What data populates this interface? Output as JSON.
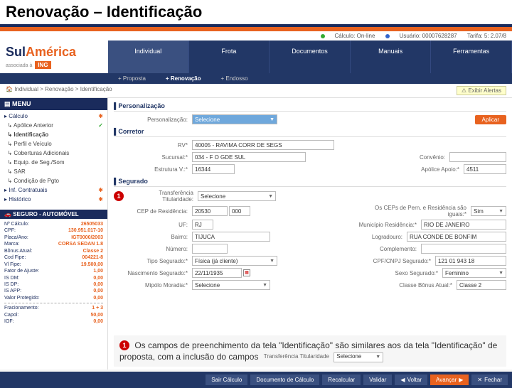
{
  "slide_title": "Renovação – Identificação",
  "status": {
    "calc": "Cálculo: On-line",
    "user": "Usuário: 00007628287",
    "tarifa": "Tarifa: 5: 2.07/8"
  },
  "logo": {
    "brand": "SulAmérica",
    "sub": "associada à",
    "ing": "ING"
  },
  "nav": [
    "Individual",
    "Frota",
    "Documentos",
    "Manuais",
    "Ferramentas"
  ],
  "subnav": [
    "+ Proposta",
    "+ Renovação",
    "+ Endosso"
  ],
  "breadcrumb": "Individual > Renovação > Identificação",
  "alert_btn": "⚠ Exibir Alertas",
  "menu_head": "MENU",
  "menu": {
    "calc": "Cálculo",
    "apolice": "Apólice Anterior",
    "ident": "Identificação",
    "perfil": "Perfil e Veículo",
    "cob": "Coberturas Adicionais",
    "equip": "Equip. de Seg./Som",
    "sar": "SAR",
    "cond": "Condição de Pgto",
    "info": "Inf. Contratuais",
    "hist": "Histórico"
  },
  "summary_head": "SEGURO - AUTOMÓVEL",
  "summary": {
    "ncalc_k": "Nº Cálculo:",
    "ncalc_v": "26505033",
    "cpf_k": "CPF:",
    "cpf_v": "130.951.017-10",
    "placa_k": "Placa/Ano:",
    "placa_v": "IGT0000/2003",
    "marca_k": "Marca:",
    "marca_v": "CORSA SEDAN 1.8",
    "bonus_k": "Bônus Atual:",
    "bonus_v": "Classe 2",
    "cod_k": "Cod Fipe:",
    "cod_v": "004221-8",
    "vl_k": "Vl Fipe:",
    "vl_v": "19.500,00",
    "fator_k": "Fator de Ajuste:",
    "fator_v": "1,00",
    "dm_k": "IS DM:",
    "dm_v": "0,00",
    "dp_k": "IS DP:",
    "dp_v": "0,00",
    "app_k": "IS APP:",
    "app_v": "0,00",
    "prot_k": "Valor Protegido:",
    "prot_v": "0,00",
    "frac_k": "Fracionamento:",
    "frac_v": "1 + 3",
    "capol_k": "Capol:",
    "capol_v": "50,00",
    "iof_k": "IOF:",
    "iof_v": "0,00"
  },
  "sections": {
    "personal": "Personalização",
    "personal_lbl": "Personalização:",
    "personal_val": "Selecione",
    "apply": "Aplicar",
    "corretor": "Corretor",
    "rv_lbl": "RV*",
    "rv_val": "40005 - RAVIMA CORR DE SEGS",
    "suc_lbl": "Sucursal:*",
    "suc_val": "034 - F O GDE SUL",
    "conv_lbl": "Convênio:",
    "est_lbl": "Estrutura V.:*",
    "est_val": "16344",
    "apol_lbl": "Apólice Apoio:*",
    "apol_val": "4511",
    "segurado": "Segurado",
    "transf_lbl": "Transferência Titularidade:",
    "transf_val": "Selecione",
    "cep_lbl": "CEP de Residência:",
    "cep_val": "20530 000",
    "ceps_lbl": "Os CEPs de Pern. e Residência são iguais:*",
    "ceps_val": "Sim",
    "uf_lbl": "UF:",
    "uf_val": "RJ",
    "mun_lbl": "Município Residência:*",
    "mun_val": "RIO DE JANEIRO",
    "bairro_lbl": "Bairro:",
    "bairro_val": "TIJUCA",
    "log_lbl": "Logradouro:",
    "log_val": "RUA CONDE DE BONFIM",
    "num_lbl": "Número:",
    "comp_lbl": "Complemento:",
    "tipo_lbl": "Tipo Segurado:*",
    "tipo_val": "Física (já cliente)",
    "cpf2_lbl": "CPF/CNPJ Segurado:*",
    "cpf2_val": "121 01 943 18",
    "nasc_lbl": "Nascimento Segurado:*",
    "nasc_val": "22/11/1935",
    "sexo_lbl": "Sexo Segurado:*",
    "sexo_val": "Feminino",
    "mora_lbl": "Mipólo Moradia:*",
    "mora_val": "Selecione",
    "classe_lbl": "Classe Bônus Atual:*",
    "classe_val": "Classe 2"
  },
  "callout": {
    "num": "1",
    "text": "Os campos de preenchimento da tela \"Identificação\" são similares aos da tela \"Identificação\" de proposta, com a inclusão do campos",
    "inline_lbl": "Transferência Titularidade",
    "inline_val": "Selecione"
  },
  "footer": [
    "Sair Cálculo",
    "Documento de Cálculo",
    "Recalcular",
    "Validar",
    "Voltar",
    "Avançar",
    "Fechar"
  ]
}
